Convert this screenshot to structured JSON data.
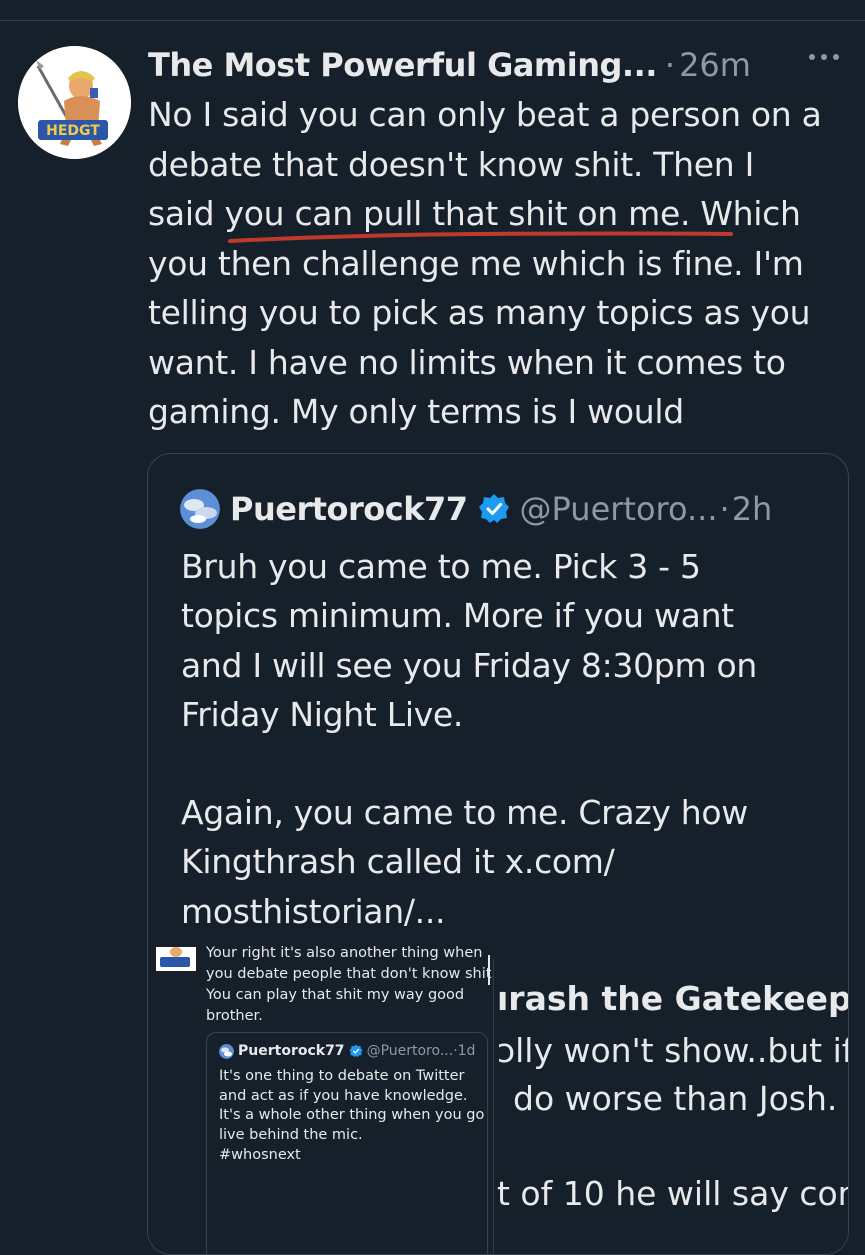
{
  "post": {
    "author_name": "The Most Powerful Gaming...",
    "separator": "·",
    "time": "26m",
    "avatar_badge": "HEDGT",
    "lines": [
      "No I said you can only beat a person on a",
      "debate that doesn't know shit. Then I",
      "said you can pull that shit on me. Which",
      "you then challenge me which is fine. I'm",
      "telling you to pick as many topics as you",
      "want. I have no limits when it comes to",
      "gaming. My only terms is I would"
    ]
  },
  "quote": {
    "author_name": "Puertorock77",
    "handle": "@Puertoro...",
    "separator": "·",
    "time": "2h",
    "lines": [
      "Bruh you came to me. Pick 3 - 5",
      "topics minimum. More if you want",
      "and I will see you Friday 8:30pm on",
      "Friday Night Live.",
      "",
      "Again, you came to me. Crazy how",
      "Kingthrash called it x.com/",
      "mosthistorian/..."
    ]
  },
  "screenshot": {
    "reply_lines": [
      "Your right it's also another thing when",
      "you debate people that don't know shit.",
      "You can play that shit my way good",
      "brother."
    ],
    "inner_quote": {
      "author_name": "Puertorock77",
      "handle": "@Puertoro...",
      "separator": "·",
      "time": "1d",
      "lines": [
        "It's one thing to debate on Twitter",
        "and act as if you have knowledge.",
        "It's a whole other thing when you go",
        "live behind the mic."
      ],
      "hashtag": "#whosnext"
    },
    "right_panel": {
      "title": "ırash the Gatekeepe",
      "line1": "ɔlly won't show..but if",
      "line2": "do worse than Josh.",
      "line3": "t of 10 he will say con"
    }
  },
  "icons": {
    "more": "more-horizontal-icon",
    "verified": "verified-badge-icon"
  },
  "colors": {
    "background": "#15202b",
    "text": "#e7e9ea",
    "secondary": "#8b98a5",
    "verified": "#1d9bf0",
    "annotation": "#c0392b"
  }
}
